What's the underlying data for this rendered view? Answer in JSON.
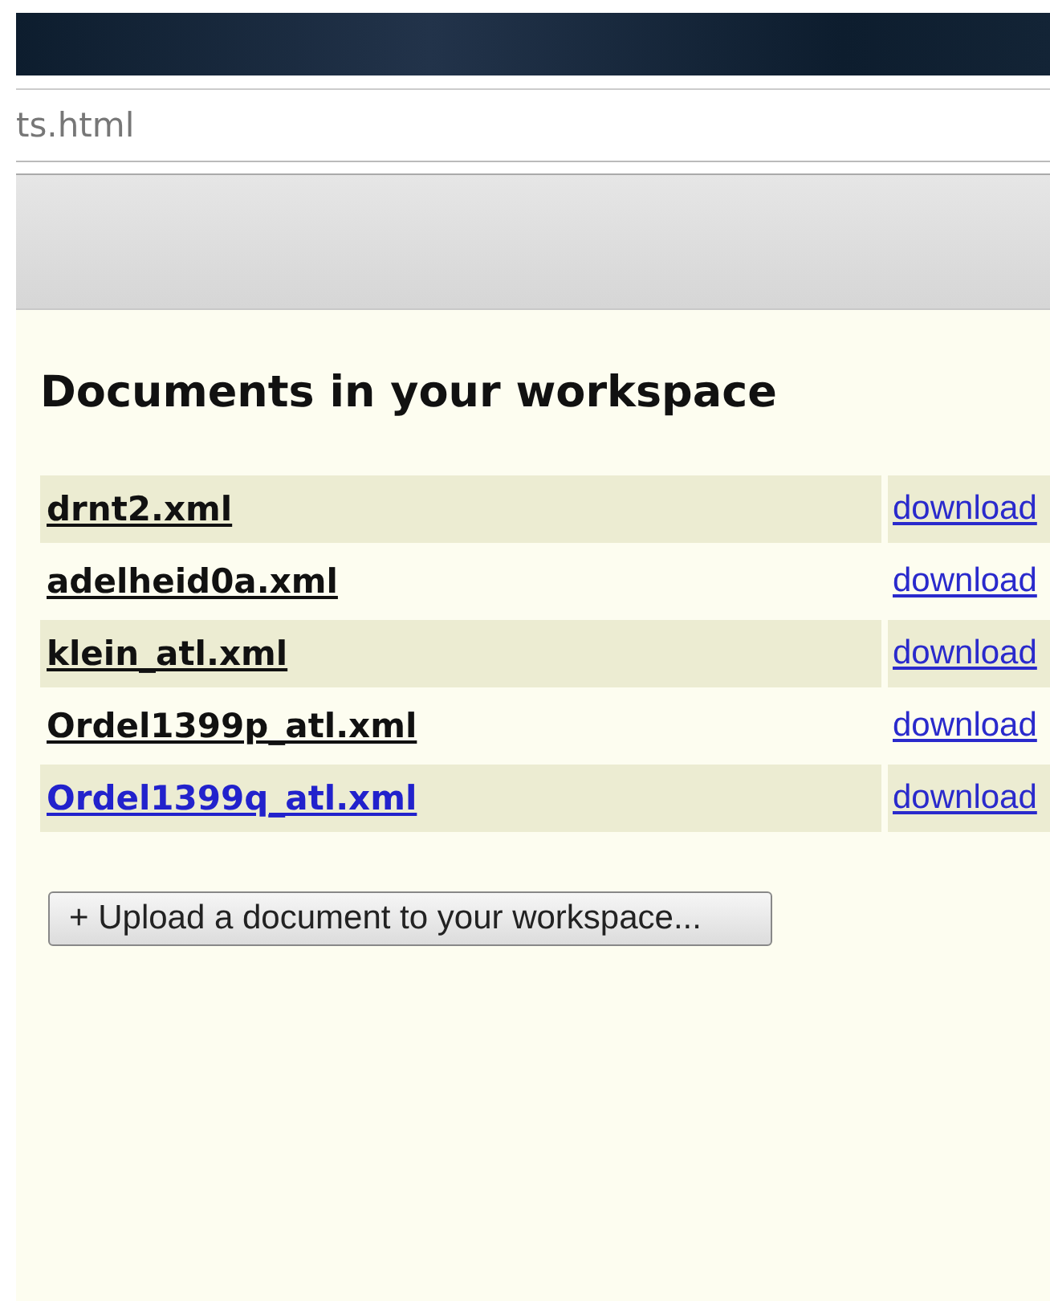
{
  "address_bar": {
    "url": "ts.html"
  },
  "heading": "Documents in your workspace",
  "documents": [
    {
      "name": "drnt2.xml",
      "link": "download",
      "active": false
    },
    {
      "name": "adelheid0a.xml",
      "link": "download",
      "active": false
    },
    {
      "name": "klein_atl.xml",
      "link": "download",
      "active": false
    },
    {
      "name": "Ordel1399p_atl.xml",
      "link": "download",
      "active": false
    },
    {
      "name": "Ordel1399q_atl.xml",
      "link": "download",
      "active": true
    }
  ],
  "upload_button": "+ Upload a document to your workspace..."
}
